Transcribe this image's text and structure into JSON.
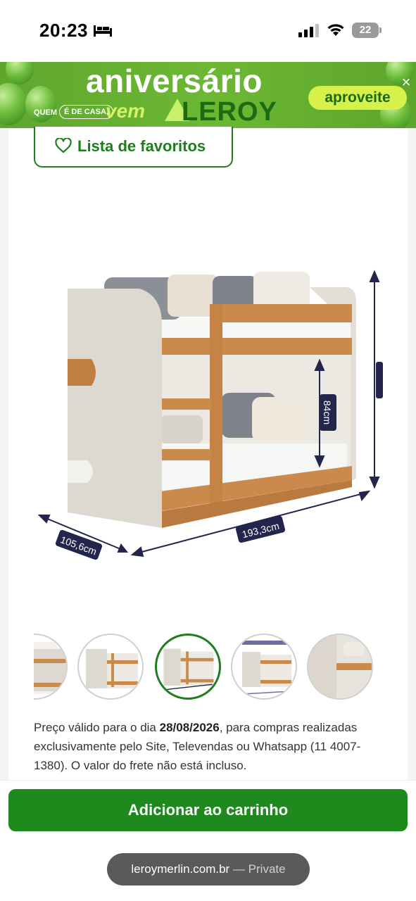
{
  "status_bar": {
    "time": "20:23",
    "battery": "22"
  },
  "promo": {
    "title": "aniversário",
    "tagline_part1": "QUEM",
    "tagline_part2": "É DE CASA,",
    "tagline_part3": "vem",
    "brand": "LEROY",
    "cta": "aproveite",
    "close_symbol": "×"
  },
  "product": {
    "favorites_label": "Lista de favoritos",
    "dimensions": {
      "width": "193,3cm",
      "depth": "105,6cm",
      "inner_height": "84cm"
    },
    "thumbnail_count": 5,
    "active_thumbnail": 3
  },
  "price_note": {
    "text_before": "Preço válido para o dia ",
    "date": "28/08/2026",
    "text_after": ", para compras realizadas exclusivamente pelo Site, Televendas ou Whatsapp (11 4007-1380). O valor do frete não está incluso."
  },
  "actions": {
    "add_to_cart": "Adicionar ao carrinho"
  },
  "browser": {
    "url": "leroymerlin.com.br",
    "separator": " — ",
    "mode": "Private"
  },
  "colors": {
    "brand_green": "#1e7e1e",
    "promo_green": "#6cb833",
    "cta_yellow": "#d7f04a"
  }
}
